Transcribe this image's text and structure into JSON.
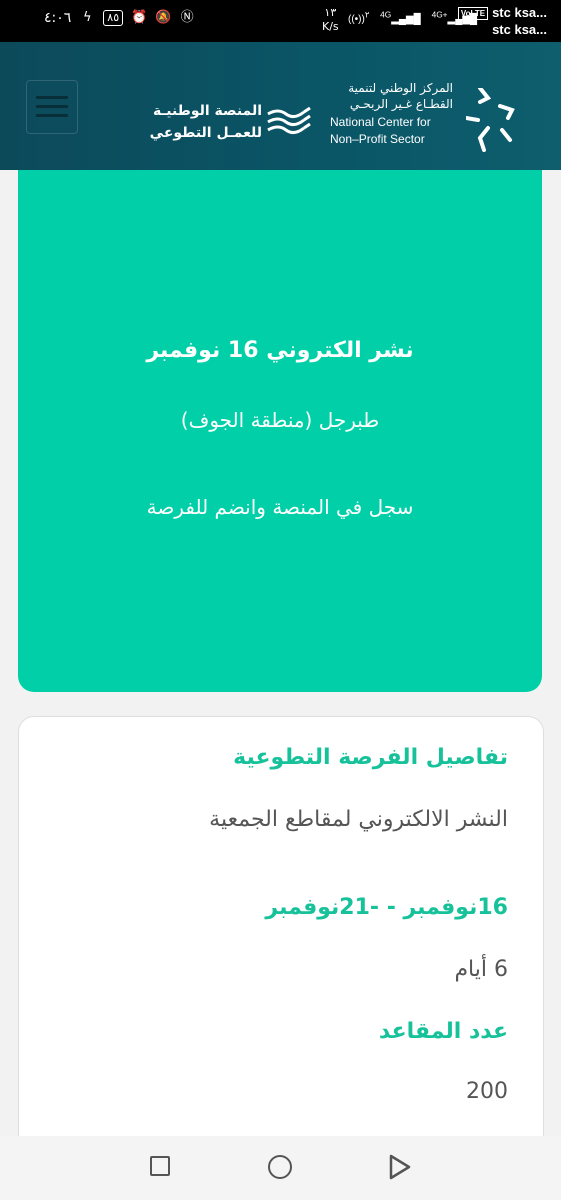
{
  "status_bar": {
    "time": "٤:٠٦",
    "battery": "٨٥",
    "carrier_1": "stc ksa...",
    "carrier_2": "stc ksa...",
    "volte": "VoLTE",
    "network_1": "4G",
    "network_2": "4G+",
    "speed_value": "١٣",
    "speed_unit": "K/s",
    "hotspot": "٢"
  },
  "header": {
    "platform_name_line1": "المنصة الوطنيـة",
    "platform_name_line2": "للعمـل التطوعي",
    "center_ar_line1": "المركز الوطني لتنمية",
    "center_ar_line2": "القطـاع غـير الربحـي",
    "center_en_line1": "National Center for",
    "center_en_line2": "Non–Profit Sector"
  },
  "hero": {
    "title": "نشر الكتروني 16 نوفمبر",
    "location": "طبرجل (منطقة الجوف)",
    "cta": "سجل في المنصة وانضم للفرصة"
  },
  "details": {
    "heading": "تفاصيل الفرصة التطوعية",
    "description": "النشر الالكتروني لمقاطع الجمعية",
    "date_range": "16نوفمبر  -  -21نوفمبر",
    "duration": "6 أيام",
    "seats_label": "عدد المقاعد",
    "seats_value": "200"
  },
  "colors": {
    "header_bg": "#0a5667",
    "hero_bg": "#00cfa8",
    "accent_green": "#17c29b"
  }
}
